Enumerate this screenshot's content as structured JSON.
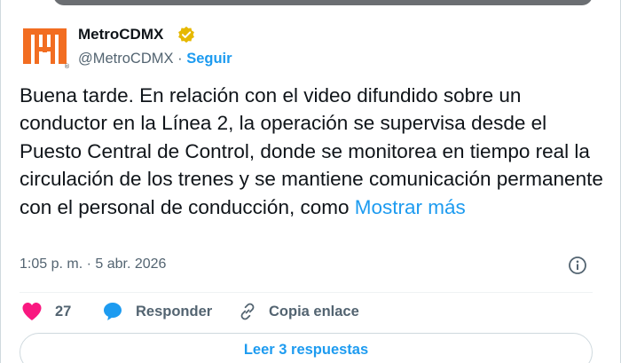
{
  "colors": {
    "accent": "#1d9bf0",
    "like": "#f91880",
    "verified": "#e6b800",
    "metro_logo": "#f26d21",
    "muted_text": "#536471"
  },
  "author": {
    "name": "MetroCDMX",
    "handle": "@MetroCDMX",
    "separator": "·",
    "follow_label": "Seguir",
    "avatar_icon": "metro-logo-icon",
    "verified_icon": "verified-badge-icon"
  },
  "tweet": {
    "text": "Buena tarde. En relación con el video difundido sobre un conductor en la Línea 2, la operación se supervisa desde el Puesto Central de Control, donde se monitorea en tiempo real la circulación de los trenes y se mantiene comunicación permanente con el personal de conducción, como ",
    "show_more_label": "Mostrar más",
    "timestamp": "1:05 p. m. · 5 abr. 2026",
    "info_icon": "info-icon"
  },
  "actions": {
    "like_count": "27",
    "like_icon": "heart-icon",
    "reply_label": "Responder",
    "reply_icon": "speech-bubble-icon",
    "copy_label": "Copia enlace",
    "copy_icon": "link-icon"
  },
  "replies": {
    "read_label": "Leer 3 respuestas"
  }
}
